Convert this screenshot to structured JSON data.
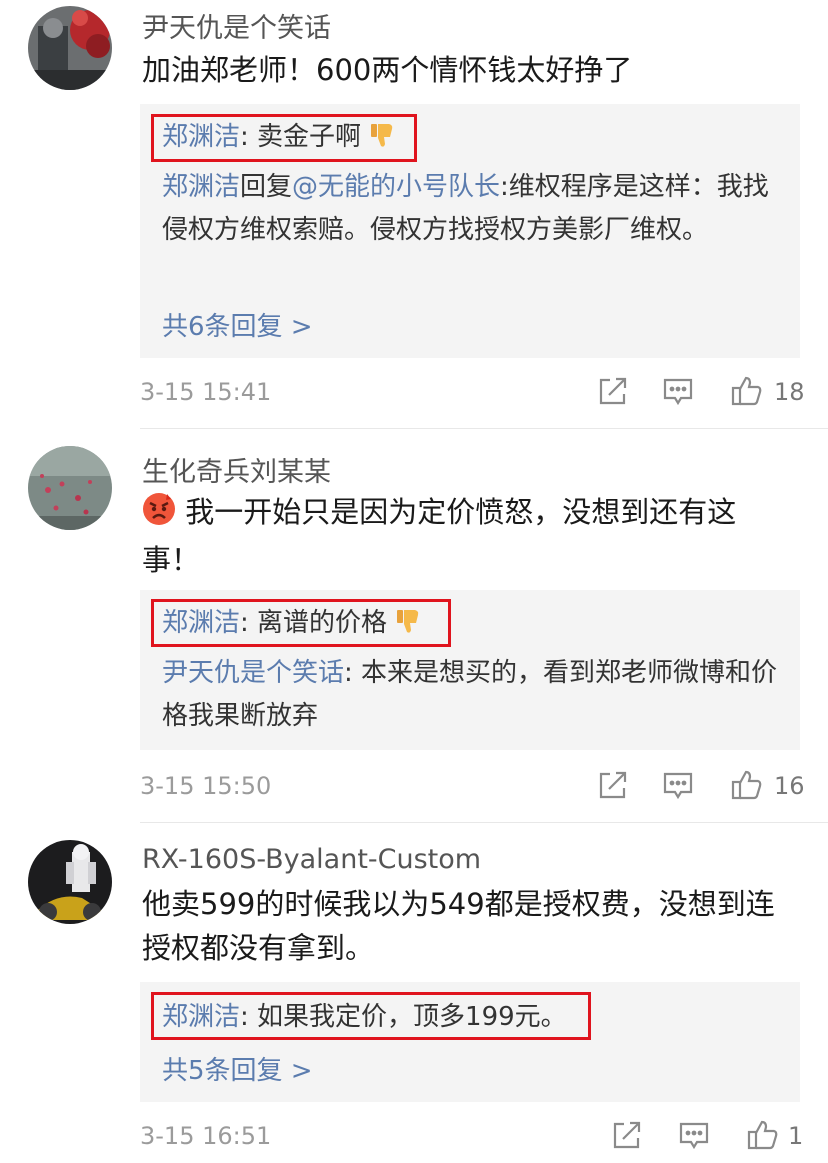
{
  "comments": [
    {
      "username": "尹天仇是个笑话",
      "text": "加油郑老师！600两个情怀钱太好挣了",
      "highlight_name": "郑渊洁",
      "highlight_text": ": 卖金子啊",
      "reply_name": "郑渊洁",
      "reply_mid": "回复",
      "reply_mention": "@无能的小号队长",
      "reply_text": ":维权程序是这样：我找侵权方维权索赔。侵权方找授权方美影厂维权。",
      "more_replies": "共6条回复 >",
      "timestamp": "3-15 15:41",
      "likes": "18"
    },
    {
      "username": "生化奇兵刘某某",
      "text": "我一开始只是因为定价愤怒，没想到还有这事！",
      "highlight_name": "郑渊洁",
      "highlight_text": ": 离谱的价格",
      "reply_name": "尹天仇是个笑话",
      "reply_text": ": 本来是想买的，看到郑老师微博和价格我果断放弃",
      "timestamp": "3-15 15:50",
      "likes": "16"
    },
    {
      "username": "RX-160S-Byalant-Custom",
      "text": "他卖599的时候我以为549都是授权费，没想到连授权都没有拿到。",
      "highlight_name": "郑渊洁",
      "highlight_text": ": 如果我定价，顶多199元。",
      "more_replies": "共5条回复 >",
      "timestamp": "3-15 16:51",
      "likes": "1"
    }
  ],
  "icons": {
    "share": "share-icon",
    "comment": "comment-icon",
    "like": "like-icon",
    "thumbs_down": "thumbs-down-emoji",
    "angry": "angry-face-emoji"
  },
  "colors": {
    "link": "#5b7cae",
    "highlight_border": "#e0141e",
    "reply_bg": "#f4f4f4"
  }
}
